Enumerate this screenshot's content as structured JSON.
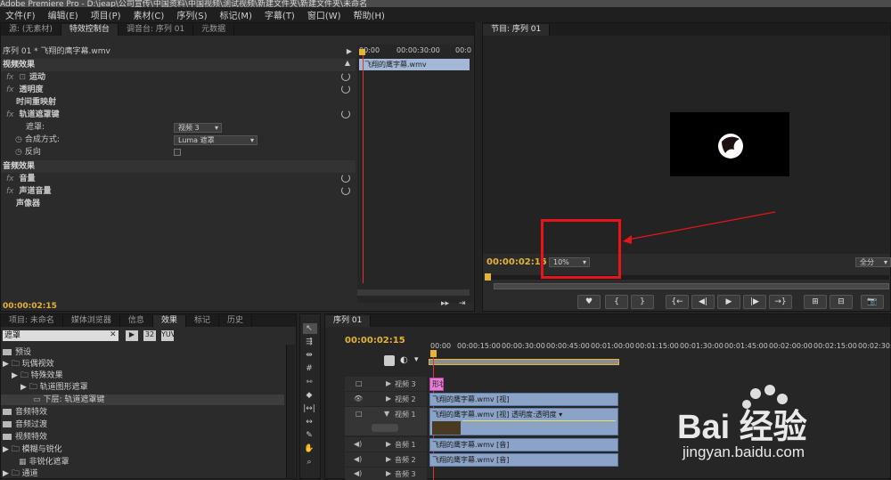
{
  "window": {
    "title": "Adobe Premiere Pro - D:\\jeap\\公司宣传\\中国资料\\中国视频\\测试视频\\新建文件夹\\新建文件夹\\未命名"
  },
  "menu": [
    "文件(F)",
    "编辑(E)",
    "项目(P)",
    "素材(C)",
    "序列(S)",
    "标记(M)",
    "字幕(T)",
    "窗口(W)",
    "帮助(H)"
  ],
  "effect_controls": {
    "tabs": [
      "源: (无素材)",
      "特效控制台",
      "调音台: 序列 01",
      "元数据"
    ],
    "sequence_label": "序列 01 * 飞翔的鹰字幕.wmv",
    "video_effects_header": "视频效果",
    "rows": [
      {
        "fx": "fx",
        "label": "运动"
      },
      {
        "fx": "fx",
        "label": "透明度"
      },
      {
        "fx": "",
        "label": "时间重映射"
      },
      {
        "fx": "fx",
        "label": "轨道遮罩键"
      }
    ],
    "matte_label": "遮罩:",
    "matte_value": "视频 3",
    "composite_label": "合成方式:",
    "composite_value": "Luma 遮罩",
    "reverse_label": "反向",
    "audio_effects_header": "音频效果",
    "audio_rows": [
      {
        "fx": "fx",
        "label": "音量"
      },
      {
        "fx": "fx",
        "label": "声道音量"
      },
      {
        "fx": "",
        "label": "声像器"
      }
    ],
    "mini_timeline": {
      "t0": "00:00",
      "t1": "00:00:30:00",
      "t2": "00:0",
      "clip": "飞翔的鹰字幕.wmv"
    },
    "timecode": "00:00:02:15"
  },
  "program": {
    "tab": "节目: 序列 01",
    "timecode": "00:00:02:15",
    "zoom": "10%",
    "fit": "全分",
    "transport": [
      "♥",
      "{",
      "}",
      "{←",
      "◀|",
      "▶",
      "|▶",
      "→}",
      "⊞",
      "⊟",
      "📷"
    ]
  },
  "project": {
    "tabs": [
      "项目: 未命名",
      "媒体浏览器",
      "信息",
      "效果",
      "标记",
      "历史"
    ],
    "search_value": "遮罩",
    "items": [
      {
        "indent": 1,
        "label": "预设"
      },
      {
        "indent": 1,
        "label": "▶ 🗀 玩偶视效"
      },
      {
        "indent": 2,
        "label": "▶ 🗀 特殊效果"
      },
      {
        "indent": 3,
        "label": "▶ 🗀 轨道图形遮罩"
      },
      {
        "indent": 4,
        "label": "下层: 轨道遮罩键"
      },
      {
        "indent": 1,
        "label": "音频特效"
      },
      {
        "indent": 1,
        "label": "音频过渡"
      },
      {
        "indent": 1,
        "label": "视频特效"
      },
      {
        "indent": 1,
        "label": "▶ 🗀 模糊与锐化"
      },
      {
        "indent": 2,
        "label": "非锐化遮罩"
      },
      {
        "indent": 1,
        "label": "▶ 🗀 通道"
      }
    ]
  },
  "timeline": {
    "tab": "序列 01",
    "timecode": "00:00:02:15",
    "ruler": [
      "00:00",
      "00:00:15:00",
      "00:00:30:00",
      "00:00:45:00",
      "00:01:00:00",
      "00:01:15:00",
      "00:01:30:00",
      "00:01:45:00",
      "00:02:00:00",
      "00:02:15:00",
      "00:02:30:00"
    ],
    "tracks": [
      {
        "name": "视频 3",
        "clip": "形状"
      },
      {
        "name": "视频 2",
        "clip": "飞翔的鹰字幕.wmv [视]"
      },
      {
        "name": "视频 1",
        "clip": "飞翔的鹰字幕.wmv [视] 透明度:透明度 ▾"
      },
      {
        "name": "音频 1",
        "clip": "飞翔的鹰字幕.wmv [音]"
      },
      {
        "name": "音频 2",
        "clip": "飞翔的鹰字幕.wmv [音]"
      },
      {
        "name": "音频 3",
        "clip": ""
      }
    ]
  },
  "watermark": {
    "brand": "Bai 经验",
    "url": "jingyan.baidu.com"
  },
  "colors": {
    "accent": "#e3b436",
    "highlight_box": "#e8141a",
    "playhead": "#d33",
    "clip_blue": "#8ba3c6",
    "pink_clip": "#e77ed6"
  }
}
